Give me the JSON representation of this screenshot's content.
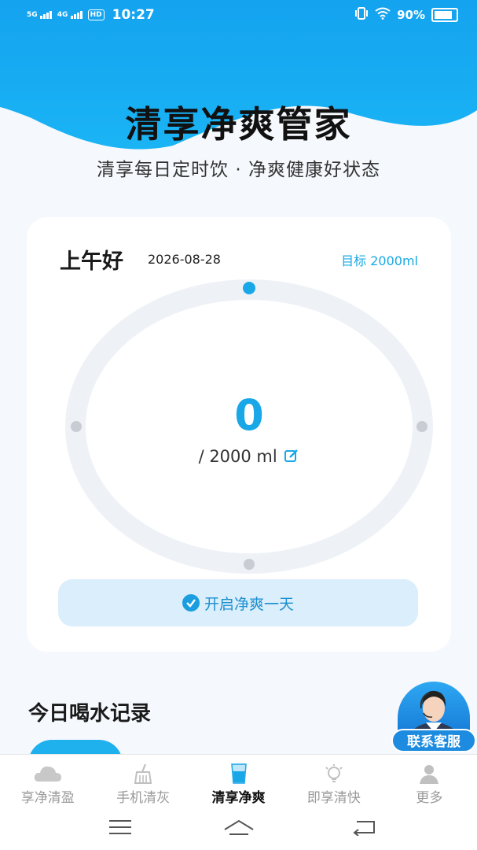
{
  "status_bar": {
    "network1": "5G",
    "network2": "4G",
    "hd": "HD",
    "time": "10:27",
    "battery": "90%"
  },
  "header": {
    "title": "清享净爽管家",
    "subtitle": "清享每日定时饮 · 净爽健康好状态"
  },
  "card": {
    "greeting": "上午好",
    "date": "2026-08-28",
    "goal": "目标 2000ml",
    "current_ml": "0",
    "total": "/ 2000 ml",
    "progress_fraction": 0,
    "start_button": "开启净爽一天"
  },
  "records": {
    "title": "今日喝水记录"
  },
  "customer_service": {
    "label": "联系客服"
  },
  "tabs": [
    {
      "label": "享净清盈",
      "icon": "cloud-icon"
    },
    {
      "label": "手机清灰",
      "icon": "broom-icon"
    },
    {
      "label": "清享净爽",
      "icon": "water-cup-icon"
    },
    {
      "label": "即享清快",
      "icon": "lightbulb-icon"
    },
    {
      "label": "更多",
      "icon": "person-icon"
    }
  ],
  "colors": {
    "accent": "#1aa7e8",
    "hero_blue": "#18a6f0",
    "tab_active": "#111111",
    "tab_inactive": "#9a9a9a"
  }
}
